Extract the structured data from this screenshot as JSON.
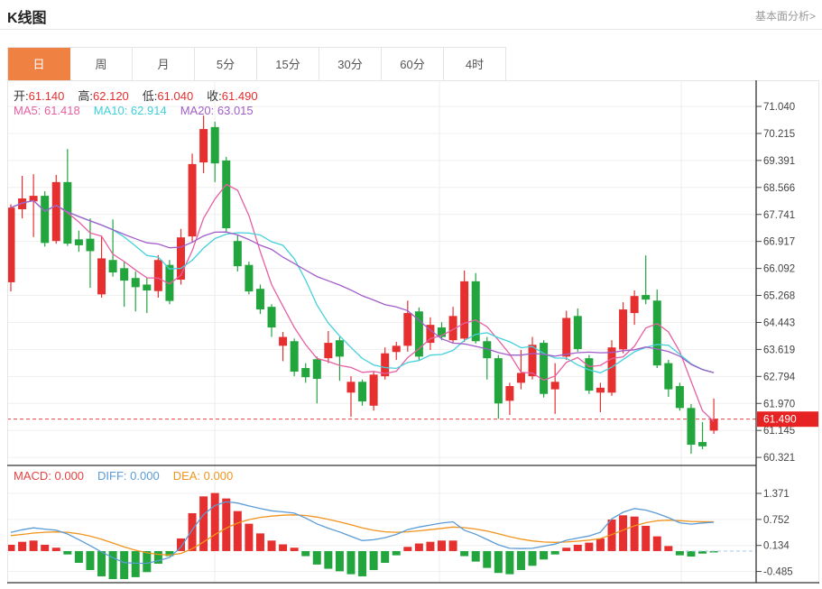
{
  "header": {
    "title": "K线图",
    "analysis_link": "基本面分析>"
  },
  "tabs": {
    "active_index": 0,
    "items": [
      {
        "id": "day",
        "label": "日"
      },
      {
        "id": "week",
        "label": "周"
      },
      {
        "id": "month",
        "label": "月"
      },
      {
        "id": "5min",
        "label": "5分"
      },
      {
        "id": "15min",
        "label": "15分"
      },
      {
        "id": "30min",
        "label": "30分"
      },
      {
        "id": "60min",
        "label": "60分"
      },
      {
        "id": "4hour",
        "label": "4时"
      }
    ]
  },
  "legend": {
    "ohlc": [
      {
        "id": "open",
        "label": "开:",
        "value": "61.140"
      },
      {
        "id": "high",
        "label": "高:",
        "value": "62.120"
      },
      {
        "id": "low",
        "label": "低:",
        "value": "61.040"
      },
      {
        "id": "close",
        "label": "收:",
        "value": "61.490"
      }
    ],
    "ma": [
      {
        "id": "ma5",
        "label": "MA5:",
        "value": "61.418",
        "color": "#e75fa2"
      },
      {
        "id": "ma10",
        "label": "MA10:",
        "value": "62.914",
        "color": "#3fd0dc"
      },
      {
        "id": "ma20",
        "label": "MA20:",
        "value": "63.015",
        "color": "#a15dc9"
      }
    ],
    "macd": [
      {
        "id": "macd",
        "label": "MACD:",
        "value": "0.000",
        "color": "#e64242"
      },
      {
        "id": "diff",
        "label": "DIFF:",
        "value": "0.000",
        "color": "#5b9bd5"
      },
      {
        "id": "dea",
        "label": "DEA:",
        "value": "0.000",
        "color": "#f0941e"
      }
    ]
  },
  "colors": {
    "up": "#e63030",
    "down": "#21a53c",
    "ma5": "#e75fa2",
    "ma10": "#45d1dc",
    "ma20": "#a15dc9",
    "diff_line": "#5b9bd5",
    "dea_line": "#f0941e",
    "tab_active": "#ef8143",
    "price_badge": "#e62222",
    "grid": "#efefef",
    "vgrid": "#ececec",
    "axis": "#444",
    "light_border": "#e5e5e5",
    "dark_border": "#333",
    "current_line": "#e64040",
    "zero_dash": "#a6c9e8"
  },
  "chart_data": {
    "type": "candlestick",
    "panels": [
      {
        "name": "price",
        "type": "candlestick",
        "y_ticks": [
          "71.040",
          "70.215",
          "69.391",
          "68.566",
          "67.741",
          "66.917",
          "66.092",
          "65.268",
          "64.443",
          "63.619",
          "62.794",
          "61.970",
          "61.145",
          "60.321"
        ],
        "ylim": [
          60.05,
          71.85
        ],
        "current_price": {
          "label": "61.490",
          "value": 61.49
        },
        "ma_periods": [
          5,
          10,
          20
        ],
        "candles_format": [
          "open",
          "high",
          "low",
          "close"
        ],
        "candles": [
          [
            65.67,
            68.05,
            65.39,
            67.95
          ],
          [
            67.9,
            68.92,
            67.62,
            68.23
          ],
          [
            68.14,
            68.97,
            67.05,
            68.31
          ],
          [
            68.31,
            68.45,
            66.76,
            66.87
          ],
          [
            66.93,
            68.95,
            66.85,
            68.73
          ],
          [
            68.73,
            69.74,
            66.78,
            66.85
          ],
          [
            66.98,
            67.25,
            66.6,
            66.8
          ],
          [
            67.0,
            67.62,
            65.5,
            66.62
          ],
          [
            65.3,
            67.1,
            65.2,
            66.4
          ],
          [
            66.35,
            67.59,
            65.84,
            65.97
          ],
          [
            66.1,
            66.3,
            64.92,
            65.72
          ],
          [
            65.8,
            66.0,
            64.78,
            65.52
          ],
          [
            65.6,
            65.8,
            64.73,
            65.42
          ],
          [
            65.4,
            66.5,
            65.2,
            66.35
          ],
          [
            66.2,
            66.35,
            65.0,
            65.1
          ],
          [
            65.75,
            67.3,
            65.6,
            67.04
          ],
          [
            67.07,
            69.6,
            66.9,
            69.28
          ],
          [
            69.33,
            70.76,
            69.0,
            70.35
          ],
          [
            70.41,
            70.57,
            68.73,
            69.3
          ],
          [
            69.39,
            69.5,
            67.2,
            67.32
          ],
          [
            66.93,
            67.1,
            66.0,
            66.16
          ],
          [
            66.2,
            66.3,
            65.3,
            65.39
          ],
          [
            65.47,
            65.6,
            64.7,
            64.84
          ],
          [
            64.92,
            65.0,
            64.0,
            64.29
          ],
          [
            63.73,
            64.15,
            63.26,
            64.0
          ],
          [
            63.87,
            63.95,
            62.8,
            62.94
          ],
          [
            63.05,
            63.2,
            62.6,
            62.77
          ],
          [
            63.32,
            63.4,
            61.97,
            62.72
          ],
          [
            63.35,
            64.18,
            63.2,
            63.82
          ],
          [
            63.9,
            64.0,
            62.66,
            63.4
          ],
          [
            62.3,
            62.8,
            61.56,
            62.63
          ],
          [
            62.63,
            62.7,
            61.9,
            62.03
          ],
          [
            61.9,
            62.95,
            61.75,
            62.85
          ],
          [
            62.8,
            63.68,
            62.7,
            63.5
          ],
          [
            63.54,
            63.85,
            63.3,
            63.73
          ],
          [
            63.73,
            65.11,
            63.55,
            64.73
          ],
          [
            64.78,
            64.9,
            63.3,
            63.4
          ],
          [
            63.82,
            64.6,
            63.6,
            64.37
          ],
          [
            64.29,
            64.45,
            63.9,
            64.0
          ],
          [
            63.9,
            64.92,
            63.8,
            64.64
          ],
          [
            63.95,
            66.03,
            63.85,
            65.7
          ],
          [
            65.7,
            65.95,
            63.8,
            63.87
          ],
          [
            63.87,
            64.0,
            62.7,
            63.35
          ],
          [
            63.35,
            63.45,
            61.5,
            61.97
          ],
          [
            62.05,
            62.6,
            61.62,
            62.5
          ],
          [
            62.6,
            63.6,
            62.4,
            62.9
          ],
          [
            62.8,
            64.0,
            62.7,
            63.76
          ],
          [
            63.82,
            63.9,
            62.15,
            62.26
          ],
          [
            62.4,
            63.2,
            61.65,
            62.63
          ],
          [
            63.4,
            64.8,
            63.3,
            64.58
          ],
          [
            64.64,
            64.87,
            63.55,
            63.63
          ],
          [
            63.35,
            63.45,
            62.26,
            62.36
          ],
          [
            62.3,
            62.6,
            61.7,
            62.45
          ],
          [
            62.3,
            63.9,
            62.2,
            63.68
          ],
          [
            63.62,
            65.06,
            63.5,
            64.84
          ],
          [
            64.73,
            65.42,
            64.37,
            65.25
          ],
          [
            65.28,
            66.49,
            65.0,
            65.14
          ],
          [
            65.11,
            65.45,
            63.05,
            63.13
          ],
          [
            63.2,
            63.3,
            62.17,
            62.4
          ],
          [
            62.5,
            62.6,
            61.75,
            61.83
          ],
          [
            61.83,
            61.95,
            60.43,
            60.71
          ],
          [
            60.79,
            61.4,
            60.57,
            60.66
          ],
          [
            61.14,
            62.12,
            61.04,
            61.49
          ]
        ]
      },
      {
        "name": "macd",
        "type": "bar",
        "y_ticks": [
          "1.371",
          "0.752",
          "0.134",
          "-0.485"
        ],
        "histogram": [
          0.15,
          0.22,
          0.25,
          0.15,
          0.08,
          -0.08,
          -0.28,
          -0.45,
          -0.6,
          -0.7,
          -0.75,
          -0.62,
          -0.5,
          -0.3,
          -0.12,
          0.3,
          0.9,
          1.3,
          1.38,
          1.25,
          0.95,
          0.65,
          0.42,
          0.25,
          0.16,
          0.08,
          -0.12,
          -0.32,
          -0.42,
          -0.48,
          -0.55,
          -0.6,
          -0.45,
          -0.28,
          -0.1,
          0.1,
          0.18,
          0.22,
          0.25,
          0.25,
          -0.12,
          -0.25,
          -0.4,
          -0.52,
          -0.55,
          -0.45,
          -0.35,
          -0.2,
          -0.08,
          0.08,
          0.15,
          0.2,
          0.3,
          0.75,
          0.85,
          0.82,
          0.6,
          0.35,
          0.12,
          -0.1,
          -0.13,
          -0.06,
          -0.02
        ]
      }
    ]
  }
}
